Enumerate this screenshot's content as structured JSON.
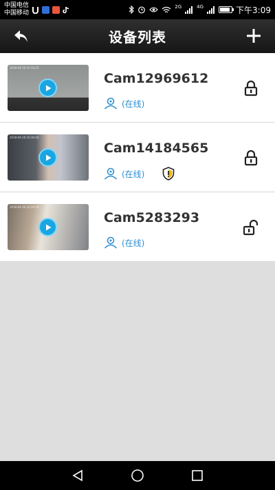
{
  "status_bar": {
    "carrier_1": "中国电信",
    "carrier_2": "中国移动",
    "net_tag_1": "2G",
    "net_tag_2": "4G",
    "time": "下午3:09",
    "battery_level": 0.85
  },
  "header": {
    "title": "设备列表",
    "back_icon": "back-arrow-icon",
    "add_icon": "plus-icon"
  },
  "devices": [
    {
      "name": "Cam12969612",
      "status": "(在线)",
      "locked": true,
      "alert": false,
      "thumb_stamp": "2018-04-26 16:33:25"
    },
    {
      "name": "Cam14184565",
      "status": "(在线)",
      "locked": true,
      "alert": true,
      "thumb_stamp": "2018-04-26 16:30:44"
    },
    {
      "name": "Cam5283293",
      "status": "(在线)",
      "locked": false,
      "alert": false,
      "thumb_stamp": "2018-04-26 16:26:19"
    }
  ],
  "colors": {
    "accent": "#2d8fd1",
    "play_button": "#1aa6e0",
    "header_bg": "#1f1f1f",
    "empty_area": "#dedede"
  }
}
